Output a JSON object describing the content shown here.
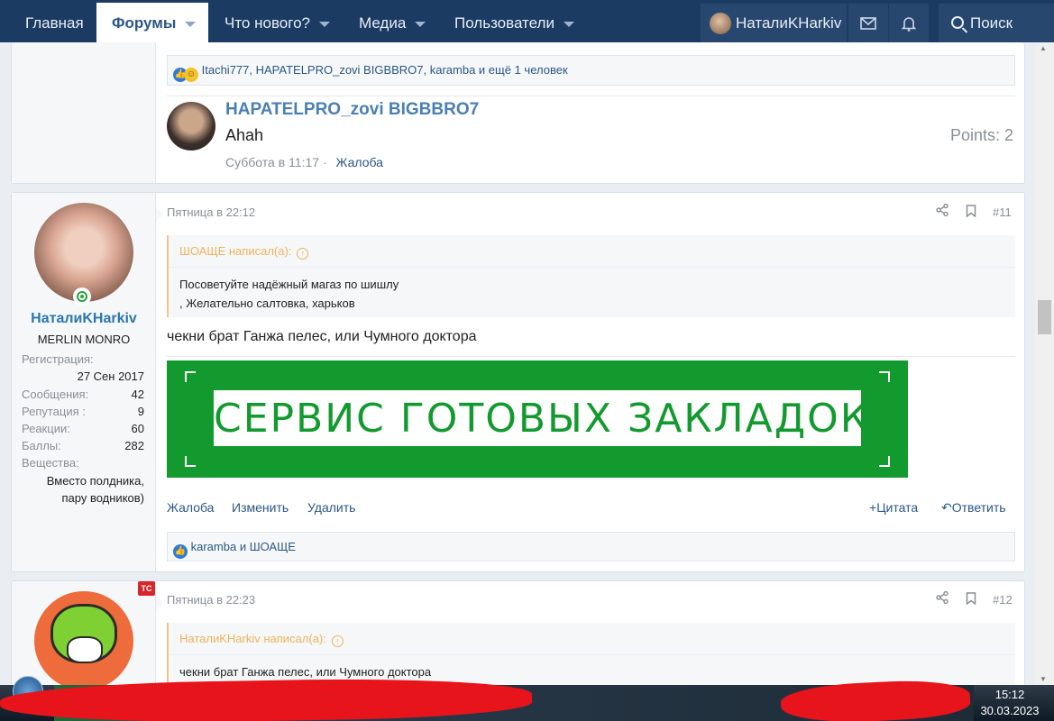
{
  "nav": {
    "home": "Главная",
    "forums": "Форумы",
    "whats_new": "Что нового?",
    "media": "Медиа",
    "members": "Пользователи",
    "username": "НаталиKHarkiv",
    "search": "Поиск"
  },
  "top_post": {
    "reactions_text": "Itachi777, HAPATELPRO_zovi BIGBBRO7, karamba и ещё 1 человек",
    "comment": {
      "author": "HAPATELPRO_zovi BIGBBRO7",
      "text": "Ahah",
      "points": "Points: 2",
      "date": "Суббота в 11:17",
      "separator": "·",
      "report": "Жалоба"
    }
  },
  "post11": {
    "date": "Пятница в 22:12",
    "number": "#11",
    "user": {
      "name": "НаталиKHarkiv",
      "title": "MERLIN MONRO",
      "stats": [
        {
          "label": "Регистрация:",
          "value": ""
        },
        {
          "label": "",
          "value": "27 Сен 2017"
        },
        {
          "label": "Сообщения:",
          "value": "42"
        },
        {
          "label": "Репутация :",
          "value": "9"
        },
        {
          "label": "Реакции:",
          "value": "60"
        },
        {
          "label": "Баллы:",
          "value": "282"
        },
        {
          "label": "Вещества:",
          "value": ""
        }
      ],
      "substances_1": "Вместо полдника,",
      "substances_2": "пару водников)"
    },
    "quote": {
      "author": "ШОАЩЕ написал(а):",
      "line1": "Посоветуйте надёжный магаз по шишлу",
      "line2": ", Желательно салтовка, харьков"
    },
    "text": "чекни брат Ганжа пелес, или Чумного доктора",
    "banner_text": "СЕРВИС ГОТОВЫХ ЗАКЛАДОК",
    "actions": {
      "report": "Жалоба",
      "edit": "Изменить",
      "delete": "Удалить",
      "quote": "Цитата",
      "reply": "Ответить"
    },
    "reactions_text": "karamba и ШОАЩЕ"
  },
  "post12": {
    "date": "Пятница в 22:23",
    "number": "#12",
    "badge": "TC",
    "quote": {
      "author": "НаталиKHarkiv написал(а):",
      "line1": "чекни брат Ганжа пелес, или Чумного доктора"
    }
  },
  "taskbar": {
    "time": "15:12",
    "date": "30.03.2023"
  },
  "colors": {
    "nav_bg": "#1b3b63",
    "link": "#2b5785",
    "banner_green": "#139a2f",
    "quote_accent": "#f0b25a"
  }
}
